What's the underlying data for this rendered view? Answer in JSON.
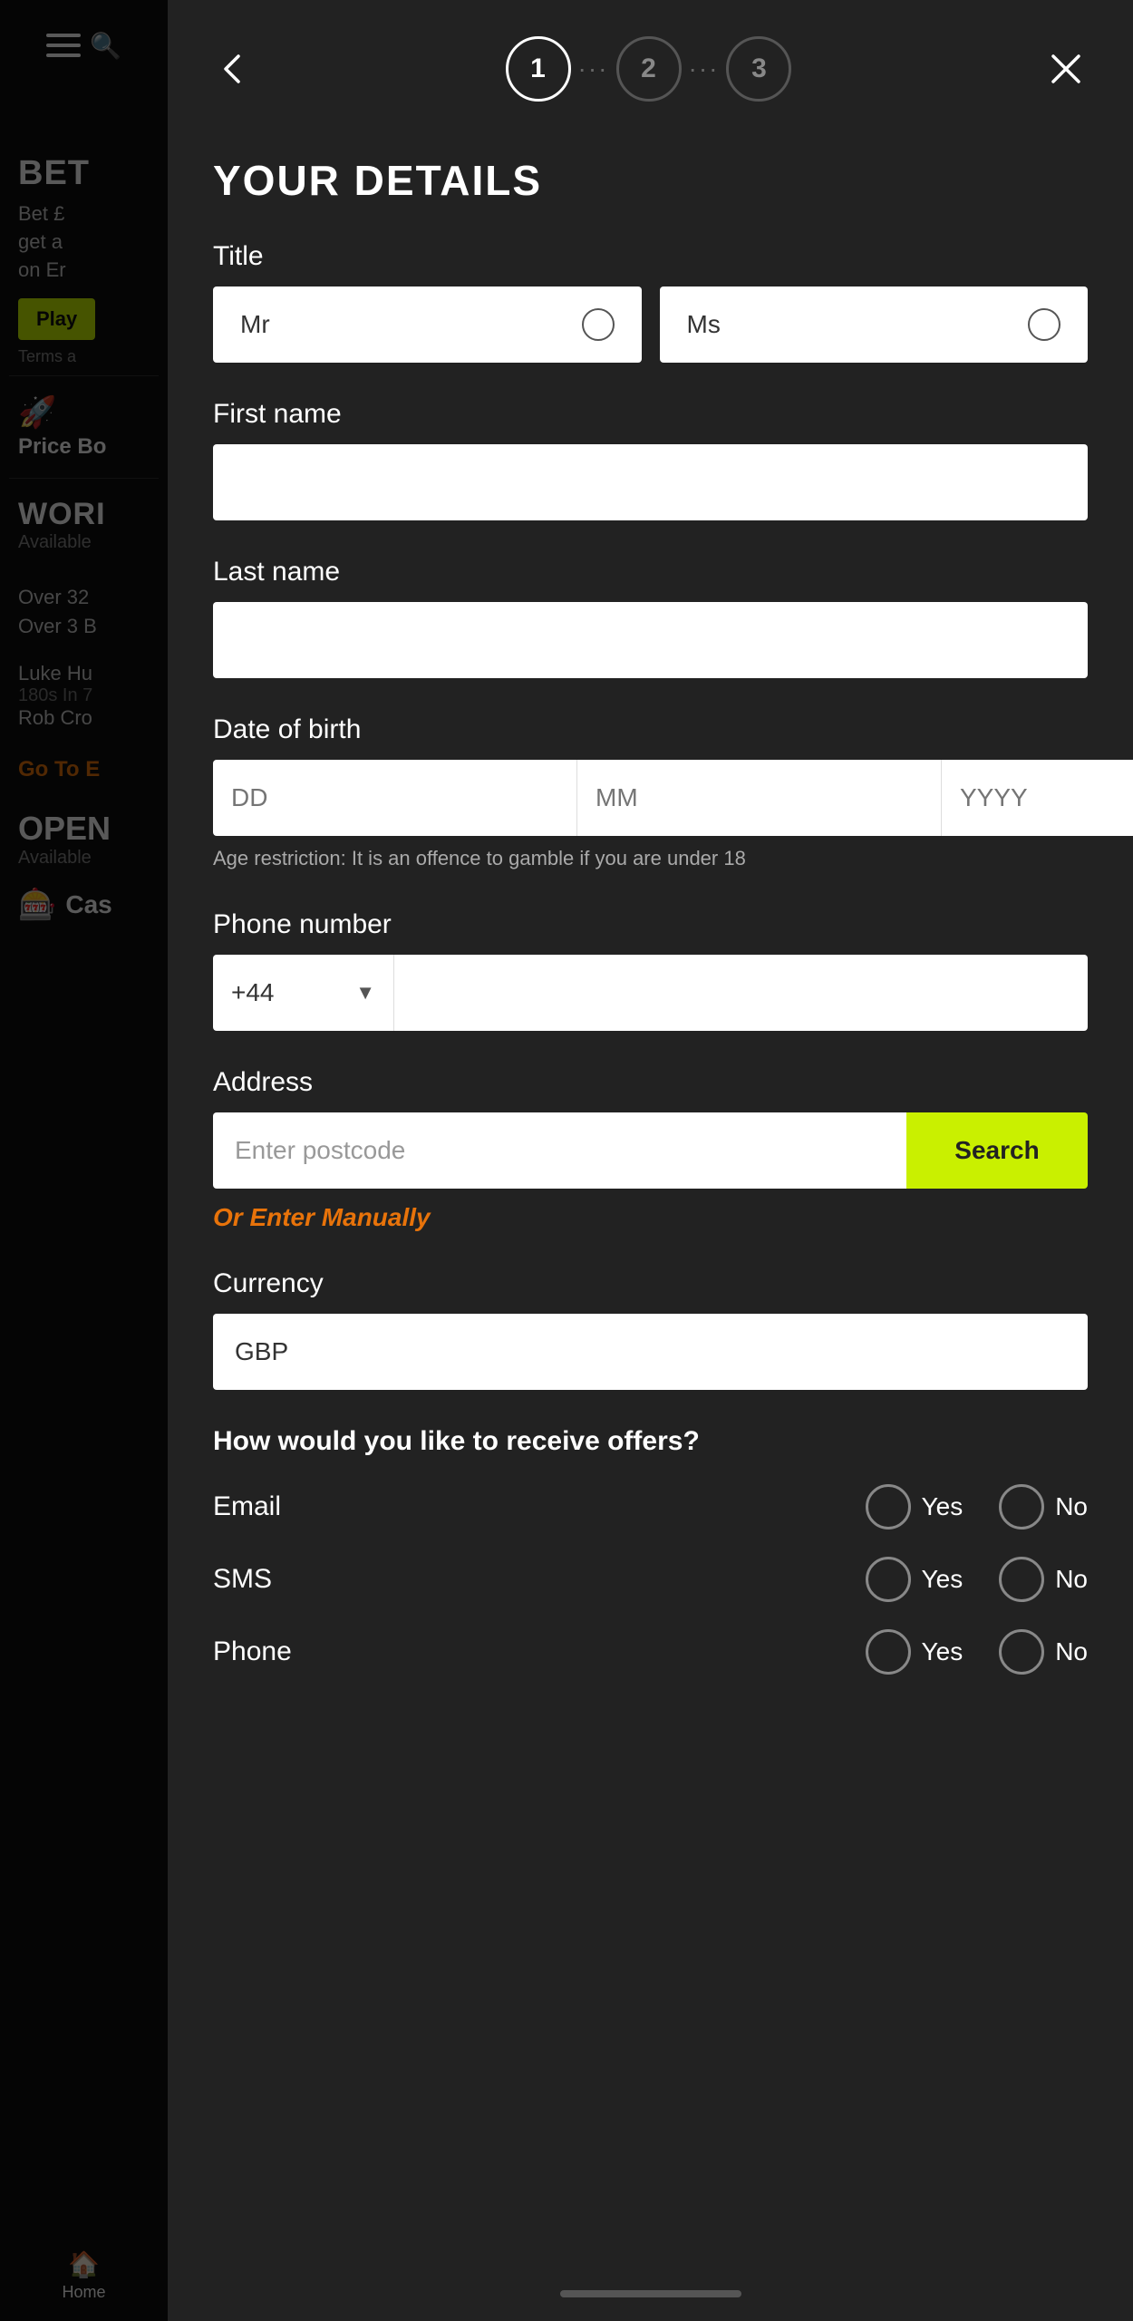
{
  "background": {
    "bet_title": "BET",
    "bet_sub": "Bet £\nget a\non Er",
    "play_label": "Play",
    "terms_label": "Terms a",
    "price_boost_label": "Price Bo",
    "world_title": "WORI",
    "available_label": "Available",
    "odd_1": "Over 32",
    "odd_2": "Over 3 B",
    "player_1": "Luke Hu",
    "player_1_sub": "180s In 7",
    "player_2": "Rob Cro",
    "goto_label": "Go To E",
    "open_label": "OPEN",
    "open_available": "Available",
    "casino_label": "Cas",
    "home_label": "Home"
  },
  "modal": {
    "title": "YOUR DETAILS",
    "back_label": "←",
    "close_label": "✕",
    "steps": [
      {
        "number": "1",
        "active": true
      },
      {
        "number": "2",
        "active": false
      },
      {
        "number": "3",
        "active": false
      }
    ],
    "form": {
      "title_label": "Title",
      "title_mr": "Mr",
      "title_ms": "Ms",
      "first_name_label": "First name",
      "first_name_placeholder": "",
      "last_name_label": "Last name",
      "last_name_placeholder": "",
      "dob_label": "Date of birth",
      "dob_dd_placeholder": "DD",
      "dob_mm_placeholder": "MM",
      "dob_yyyy_placeholder": "YYYY",
      "dob_note": "Age restriction: It is an offence to gamble if you are under 18",
      "phone_label": "Phone number",
      "phone_country_code": "+44",
      "phone_placeholder": "",
      "address_label": "Address",
      "postcode_placeholder": "Enter postcode",
      "search_label": "Search",
      "or_manual_label": "Or Enter Manually",
      "currency_label": "Currency",
      "currency_value": "GBP",
      "offers_title": "How would you like to receive offers?",
      "offers": [
        {
          "label": "Email",
          "yes_label": "Yes",
          "no_label": "No"
        },
        {
          "label": "SMS",
          "yes_label": "Yes",
          "no_label": "No"
        },
        {
          "label": "Phone",
          "yes_label": "Yes",
          "no_label": "No"
        }
      ]
    }
  },
  "colors": {
    "accent": "#c9f000",
    "orange": "#e8730a",
    "modal_bg": "#222222",
    "input_bg": "#ffffff",
    "text_primary": "#ffffff",
    "text_muted": "#aaaaaa"
  }
}
